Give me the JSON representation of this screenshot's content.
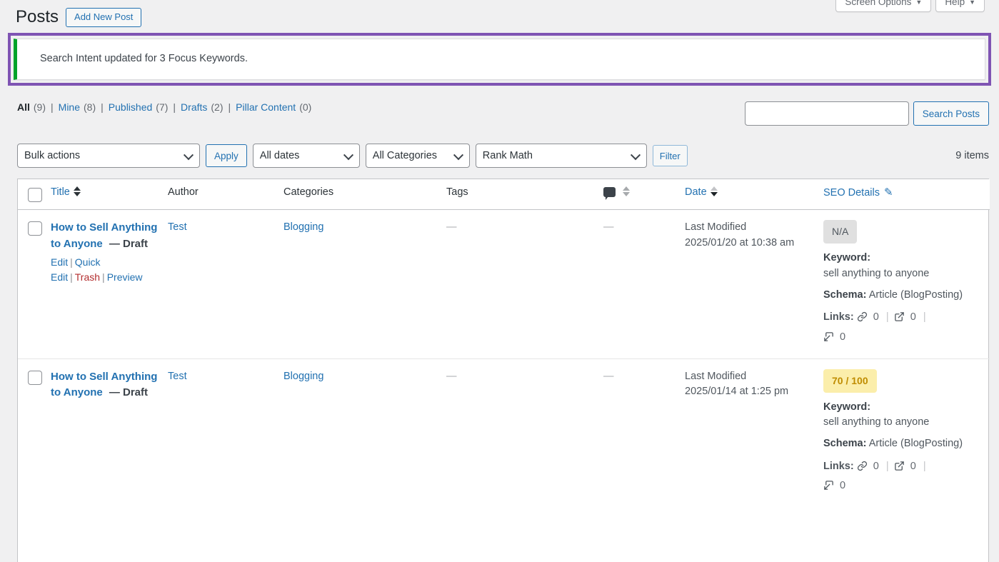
{
  "topbar": {
    "screen_options_label": "Screen Options",
    "help_label": "Help",
    "caret": "▼"
  },
  "header": {
    "title": "Posts",
    "add_new_label": "Add New Post"
  },
  "notice": {
    "message": "Search Intent updated for 3 Focus Keywords.",
    "accent_color": "#00a32a",
    "highlight_color": "#7f54b3"
  },
  "views": [
    {
      "label": "All",
      "count": "(9)",
      "current": true
    },
    {
      "label": "Mine",
      "count": "(8)",
      "current": false
    },
    {
      "label": "Published",
      "count": "(7)",
      "current": false
    },
    {
      "label": "Drafts",
      "count": "(2)",
      "current": false
    },
    {
      "label": "Pillar Content",
      "count": "(0)",
      "current": false
    }
  ],
  "search": {
    "value": "",
    "placeholder": "",
    "button_label": "Search Posts"
  },
  "tablenav": {
    "bulk_actions": "Bulk actions",
    "apply_label": "Apply",
    "all_dates": "All dates",
    "all_categories": "All Categories",
    "rank_math": "Rank Math",
    "filter_label": "Filter",
    "items_count": "9 items"
  },
  "table": {
    "columns": {
      "title": "Title",
      "author": "Author",
      "categories": "Categories",
      "tags": "Tags",
      "comments": "comments-icon",
      "date": "Date",
      "seo_details": "SEO Details"
    },
    "rows": [
      {
        "title": "How to Sell Anything to Anyone",
        "state": "— Draft",
        "actions": [
          {
            "label": "Edit",
            "kind": "edit"
          },
          {
            "label": "Quick Edit",
            "kind": "quick-edit"
          },
          {
            "label": "Trash",
            "kind": "trash"
          },
          {
            "label": "Preview",
            "kind": "preview"
          }
        ],
        "author": "Test",
        "categories": "Blogging",
        "tags": "—",
        "comments": "—",
        "date_label": "Last Modified",
        "date_value": "2025/01/20 at 10:38 am",
        "seo": {
          "score": "N/A",
          "score_type": "na",
          "keyword_label": "Keyword:",
          "keyword_value": "sell anything to anyone",
          "schema_label": "Schema:",
          "schema_value": "Article (BlogPosting)",
          "links_label": "Links:",
          "internal_links": "0",
          "external_links": "0",
          "incoming_links": "0"
        }
      },
      {
        "title": "How to Sell Anything to Anyone",
        "state": "— Draft",
        "actions": [],
        "author": "Test",
        "categories": "Blogging",
        "tags": "—",
        "comments": "—",
        "date_label": "Last Modified",
        "date_value": "2025/01/14 at 1:25 pm",
        "seo": {
          "score": "70 / 100",
          "score_type": "ok",
          "keyword_label": "Keyword:",
          "keyword_value": "sell anything to anyone",
          "schema_label": "Schema:",
          "schema_value": "Article (BlogPosting)",
          "links_label": "Links:",
          "internal_links": "0",
          "external_links": "0",
          "incoming_links": "0"
        }
      }
    ]
  }
}
